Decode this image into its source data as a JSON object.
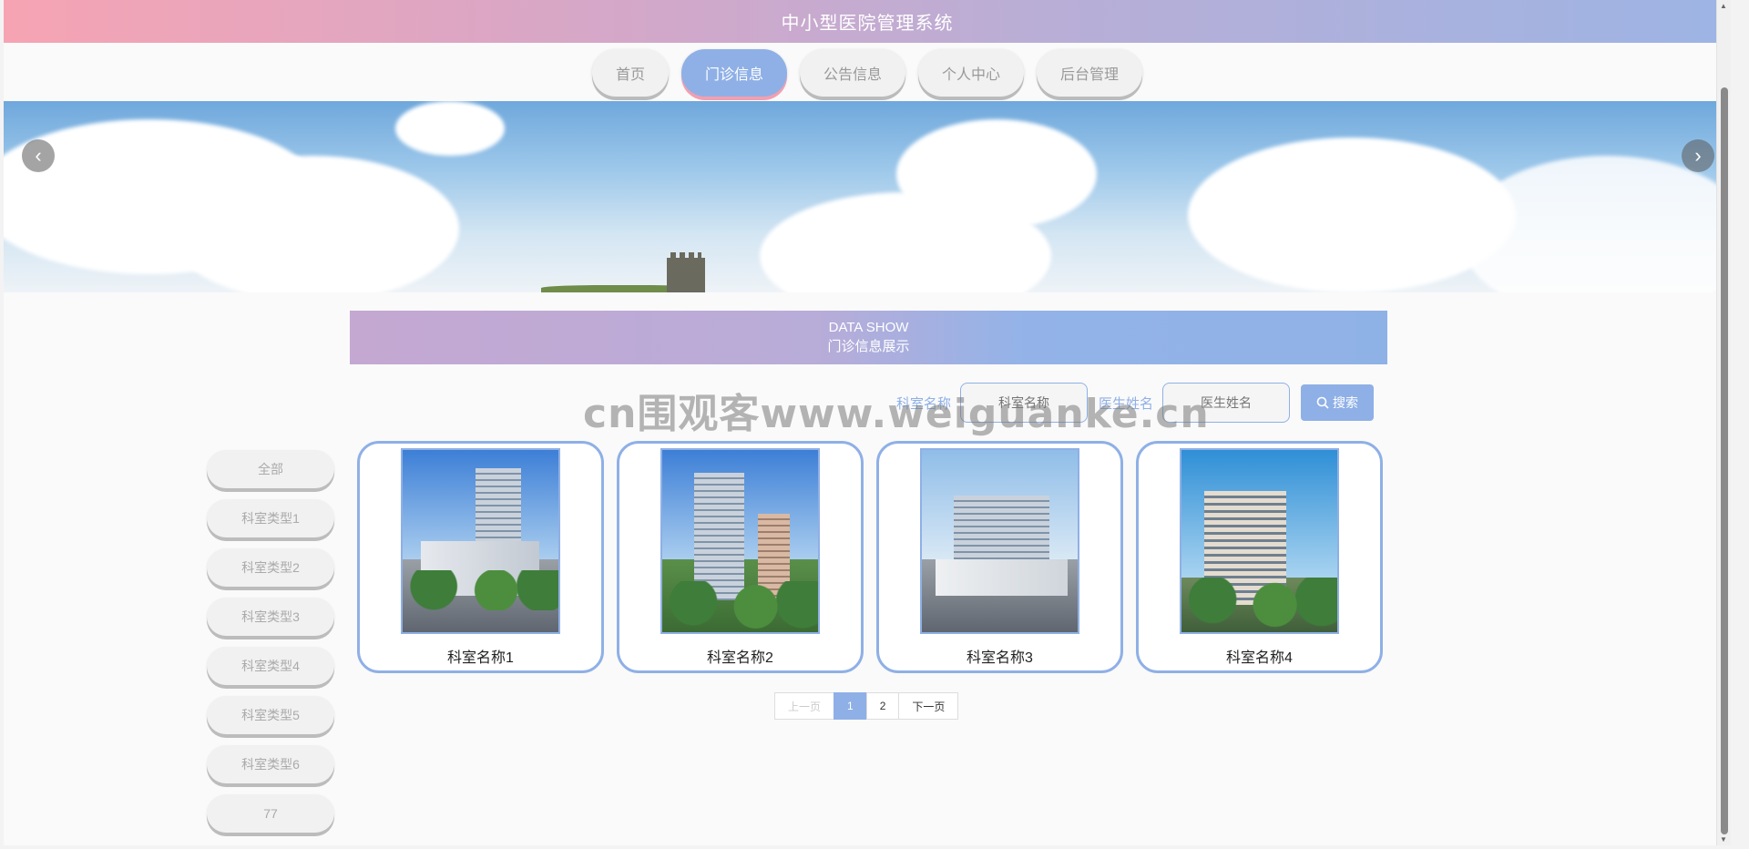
{
  "header": {
    "title": "中小型医院管理系统"
  },
  "nav": {
    "tabs": [
      {
        "label": "首页",
        "active": false
      },
      {
        "label": "门诊信息",
        "active": true
      },
      {
        "label": "公告信息",
        "active": false
      },
      {
        "label": "个人中心",
        "active": false
      },
      {
        "label": "后台管理",
        "active": false
      }
    ]
  },
  "banner": {
    "prev_icon": "chevron-left-icon",
    "next_icon": "chevron-right-icon",
    "prev_glyph": "‹",
    "next_glyph": "›"
  },
  "section": {
    "title_en": "DATA SHOW",
    "title_cn": "门诊信息展示"
  },
  "search": {
    "dept_label": "科室名称",
    "dept_placeholder": "科室名称",
    "doctor_label": "医生姓名",
    "doctor_placeholder": "医生姓名",
    "button_label": "搜索",
    "button_icon": "search-icon"
  },
  "watermark": "cn围观客www.weiguanke.cn",
  "sidebar": {
    "items": [
      {
        "label": "全部"
      },
      {
        "label": "科室类型1"
      },
      {
        "label": "科室类型2"
      },
      {
        "label": "科室类型3"
      },
      {
        "label": "科室类型4"
      },
      {
        "label": "科室类型5"
      },
      {
        "label": "科室类型6"
      },
      {
        "label": "77"
      }
    ]
  },
  "cards": [
    {
      "name": "科室名称1"
    },
    {
      "name": "科室名称2"
    },
    {
      "name": "科室名称3"
    },
    {
      "name": "科室名称4"
    }
  ],
  "pagination": {
    "prev": "上一页",
    "pages": [
      "1",
      "2"
    ],
    "current": "1",
    "next": "下一页"
  },
  "colors": {
    "accent": "#8fb0e6",
    "pink": "#f6a4b3",
    "lavender": "#c4a8d2"
  }
}
